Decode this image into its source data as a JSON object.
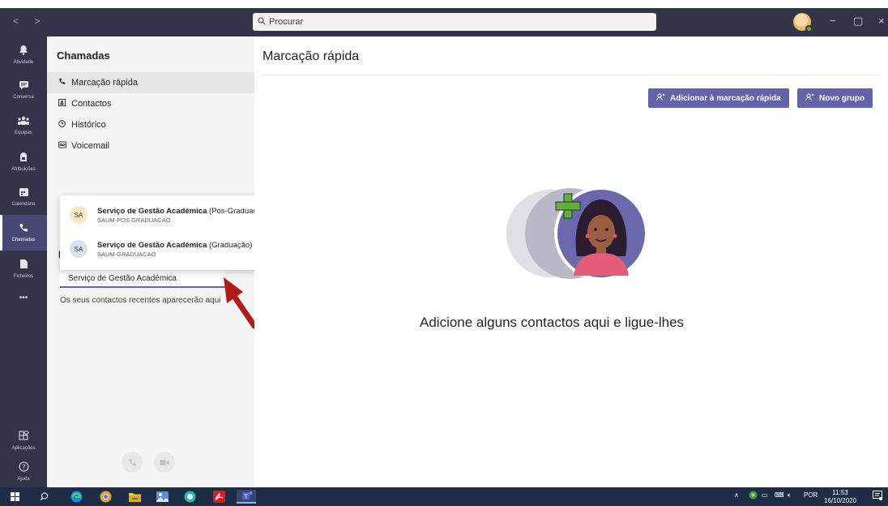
{
  "titlebar": {
    "search_placeholder": "Procurar"
  },
  "rail": {
    "items": [
      {
        "label": "Atividade",
        "icon": "bell-icon"
      },
      {
        "label": "Conversa",
        "icon": "chat-icon"
      },
      {
        "label": "Equipas",
        "icon": "teams-icon"
      },
      {
        "label": "Atribuições",
        "icon": "assignments-icon"
      },
      {
        "label": "Calendário",
        "icon": "calendar-icon"
      },
      {
        "label": "Chamadas",
        "icon": "phone-icon"
      },
      {
        "label": "Ficheiros",
        "icon": "file-icon"
      },
      {
        "label": "...",
        "icon": "more-icon"
      },
      {
        "label": "Aplicações",
        "icon": "apps-icon"
      },
      {
        "label": "Ajuda",
        "icon": "help-icon"
      }
    ],
    "more_label": "•••"
  },
  "panel": {
    "title": "Chamadas",
    "menu": [
      {
        "label": "Marcação rápida",
        "icon": "phone-icon"
      },
      {
        "label": "Contactos",
        "icon": "contacts-icon"
      },
      {
        "label": "Histórico",
        "icon": "clock-icon"
      },
      {
        "label": "Voicemail",
        "icon": "voicemail-icon"
      }
    ],
    "peek_letter": "I",
    "name_input_value": "Serviço de Gestão Académica",
    "recent_note": "Os seus contactos recentes aparecerão aqui"
  },
  "dropdown": {
    "items": [
      {
        "initials": "SA",
        "name_bold": "Serviço de Gestão Académica",
        "name_rest": " (Pós-Graduação",
        "sub": "SAUM-POS.GRADUACAO",
        "avatar_color": "#fce8c2"
      },
      {
        "initials": "SA",
        "name_bold": "Serviço de Gestão Académica",
        "name_rest": " (Graduação)",
        "sub": "SAUM-GRADUACAO",
        "avatar_color": "#d8e2ea"
      }
    ]
  },
  "main": {
    "title": "Marcação rápida",
    "btn_add": "Adicionar à marcação rápida",
    "btn_group": "Novo grupo",
    "empty_message": "Adicione alguns contactos aqui e ligue-lhes"
  },
  "taskbar": {
    "lang": "POR",
    "time": "11:53",
    "date": "16/10/2020"
  },
  "colors": {
    "accent": "#6264a7",
    "rail_bg": "#33344a",
    "taskbar_bg": "#1f2c46",
    "arrow": "#b31b1b"
  }
}
